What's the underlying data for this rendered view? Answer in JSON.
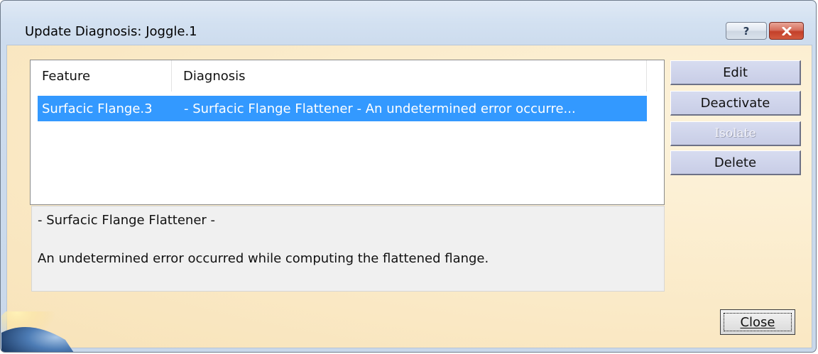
{
  "window": {
    "title": "Update Diagnosis: Joggle.1",
    "help_label": "?",
    "close_icon": "close-icon"
  },
  "list": {
    "columns": [
      "Feature",
      "Diagnosis"
    ],
    "rows": [
      {
        "feature": "Surfacic Flange.3",
        "diagnosis": "- Surfacic Flange Flattener -  An undetermined error occurre...",
        "selected": true
      }
    ]
  },
  "details": {
    "line1": "- Surfacic Flange Flattener -",
    "line2": "An undetermined error occurred while computing the flattened flange."
  },
  "buttons": {
    "edit": "Edit",
    "deactivate": "Deactivate",
    "isolate": "Isolate",
    "delete": "Delete",
    "close": "Close"
  },
  "colors": {
    "selection": "#3399ff",
    "client_bg": "#fbeccb"
  }
}
